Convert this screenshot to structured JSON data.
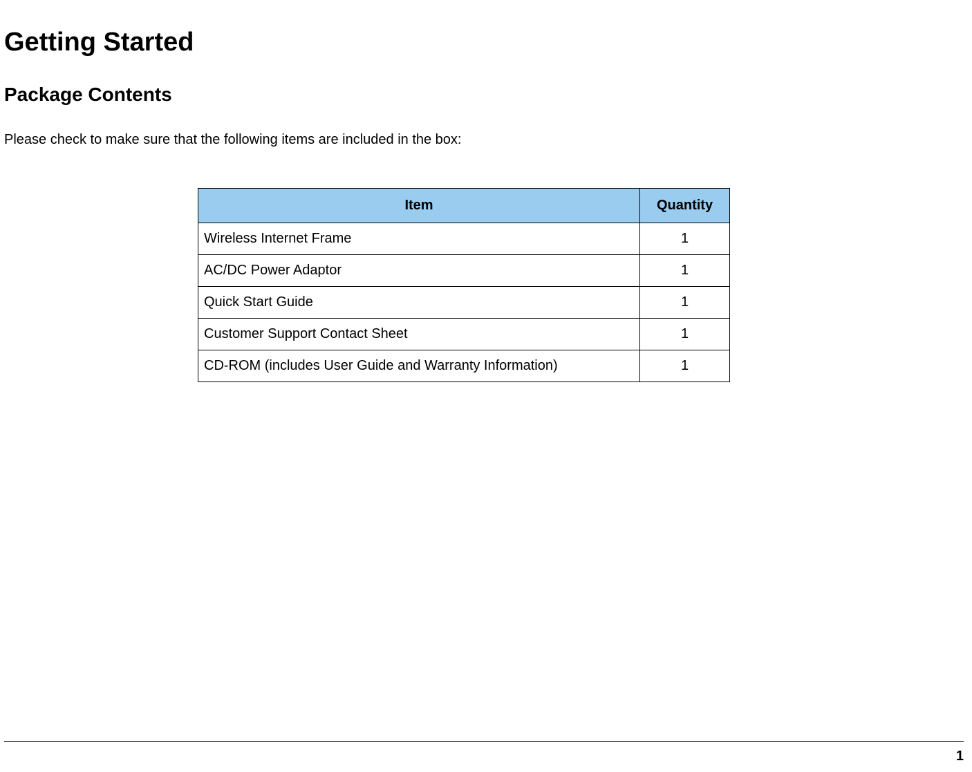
{
  "heading1": "Getting Started",
  "heading2": "Package Contents",
  "intro": "Please check to make sure that the following items are included in the box:",
  "table": {
    "headers": {
      "item": "Item",
      "quantity": "Quantity"
    },
    "rows": [
      {
        "item": "Wireless Internet Frame",
        "quantity": "1"
      },
      {
        "item": "AC/DC Power Adaptor",
        "quantity": "1"
      },
      {
        "item": "Quick Start Guide",
        "quantity": "1"
      },
      {
        "item": "Customer Support Contact Sheet",
        "quantity": "1"
      },
      {
        "item": "CD-ROM (includes User Guide and Warranty Information)",
        "quantity": "1"
      }
    ]
  },
  "pageNumber": "1",
  "chart_data": {
    "type": "table",
    "columns": [
      "Item",
      "Quantity"
    ],
    "rows": [
      [
        "Wireless Internet Frame",
        1
      ],
      [
        "AC/DC Power Adaptor",
        1
      ],
      [
        "Quick Start Guide",
        1
      ],
      [
        "Customer Support Contact Sheet",
        1
      ],
      [
        "CD-ROM (includes User Guide and Warranty Information)",
        1
      ]
    ]
  }
}
